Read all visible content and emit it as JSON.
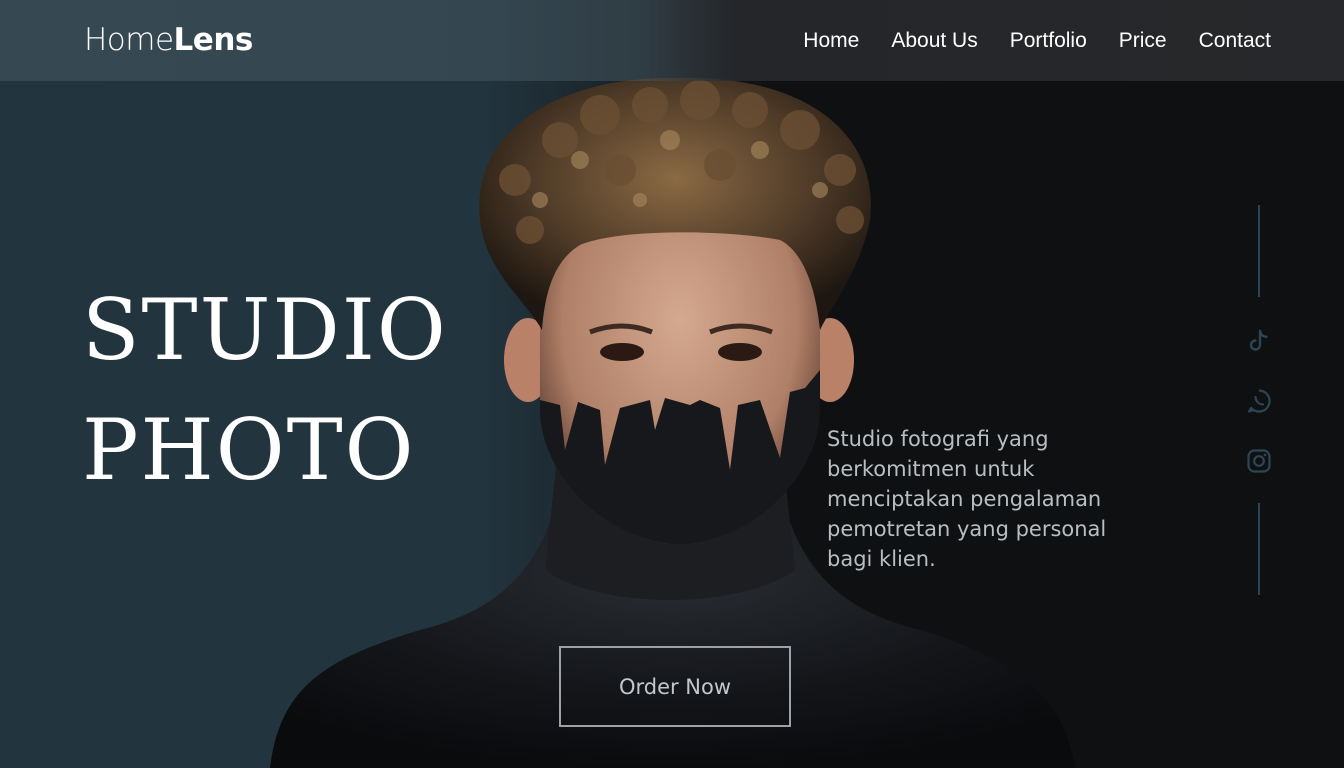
{
  "header": {
    "logo": {
      "light": "Home",
      "bold": "Lens"
    },
    "nav": [
      "Home",
      "About Us",
      "Portfolio",
      "Price",
      "Contact"
    ]
  },
  "hero": {
    "title_lines": [
      "STUDIO",
      "PHOTO"
    ],
    "tagline": "Studio fotografi yang berkomitmen untuk menciptakan pengalaman pemotretan yang personal bagi klien.",
    "cta": "Order Now"
  },
  "social": {
    "icons": [
      "tiktok-icon",
      "whatsapp-icon",
      "instagram-icon"
    ]
  },
  "colors": {
    "left_background": "#22343e",
    "right_background": "#0f1012",
    "accent_line": "#2d4653",
    "text": "#ffffff",
    "muted_text": "#b9bec3"
  }
}
